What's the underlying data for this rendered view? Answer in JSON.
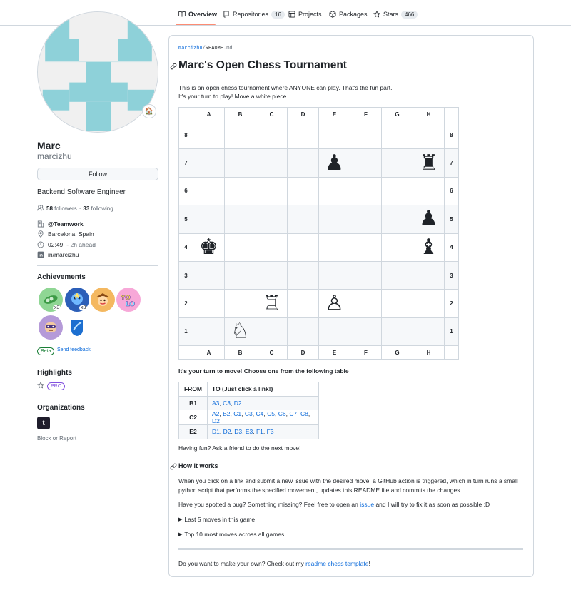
{
  "nav": {
    "tabs": [
      {
        "label": "Overview",
        "icon": "book-icon",
        "active": true
      },
      {
        "label": "Repositories",
        "icon": "repo-icon",
        "count": "16"
      },
      {
        "label": "Projects",
        "icon": "table-icon"
      },
      {
        "label": "Packages",
        "icon": "package-icon"
      },
      {
        "label": "Stars",
        "icon": "star-icon",
        "count": "466"
      }
    ]
  },
  "profile": {
    "name": "Marc",
    "login": "marcizhu",
    "follow_label": "Follow",
    "bio": "Backend Software Engineer",
    "followers_count": "58",
    "followers_label": "followers",
    "following_count": "33",
    "following_label": "following",
    "dot": "·",
    "company": "@Teamwork",
    "location": "Barcelona, Spain",
    "time": "02:49",
    "time_note": "- 2h ahead",
    "linkedin": "in/marcizhu",
    "status_emoji": "🏠"
  },
  "achievements": {
    "title": "Achievements",
    "badges": [
      {
        "name": "pair-extraordinaire",
        "multiplier": "x3",
        "color": "#8fd694"
      },
      {
        "name": "starstruck",
        "multiplier": "x3",
        "color": "#2c5fb8"
      },
      {
        "name": "quickdraw",
        "color": "#f4b860"
      },
      {
        "name": "yolo",
        "color": "#f7a8d8"
      },
      {
        "name": "pull-shark",
        "color": "#b59ad8"
      },
      {
        "name": "arctic-code-vault",
        "color": "#1d6fd0"
      }
    ],
    "beta_label": "Beta",
    "feedback_label": "Send feedback"
  },
  "highlights": {
    "title": "Highlights",
    "pro_label": "PRO"
  },
  "organizations": {
    "title": "Organizations",
    "org_letter": "t",
    "block_label": "Block or Report"
  },
  "readme": {
    "path_user": "marcizhu",
    "path_sep": "/",
    "path_file_name": "README",
    "path_file_ext": ".md",
    "title": "Marc's Open Chess Tournament",
    "intro_1": "This is an open chess tournament where ANYONE can play. That's the fun part.",
    "intro_2": "It's your turn to play! Move a white piece.",
    "board": {
      "files": [
        "A",
        "B",
        "C",
        "D",
        "E",
        "F",
        "G",
        "H"
      ],
      "ranks": [
        {
          "label": "8",
          "cells": [
            "",
            "",
            "",
            "",
            "",
            "",
            "",
            ""
          ]
        },
        {
          "label": "7",
          "cells": [
            "",
            "",
            "",
            "",
            "♟",
            "",
            "",
            "♜"
          ]
        },
        {
          "label": "6",
          "cells": [
            "",
            "",
            "",
            "",
            "",
            "",
            "",
            ""
          ]
        },
        {
          "label": "5",
          "cells": [
            "",
            "",
            "",
            "",
            "",
            "",
            "",
            "♟"
          ]
        },
        {
          "label": "4",
          "cells": [
            "♚",
            "",
            "",
            "",
            "",
            "",
            "",
            "♝"
          ]
        },
        {
          "label": "3",
          "cells": [
            "",
            "",
            "",
            "",
            "",
            "",
            "",
            ""
          ]
        },
        {
          "label": "2",
          "cells": [
            "",
            "",
            "♖",
            "",
            "♙",
            "",
            "",
            ""
          ]
        },
        {
          "label": "1",
          "cells": [
            "",
            "♘",
            "",
            "",
            "",
            "",
            "",
            ""
          ]
        }
      ]
    },
    "move_prompt": "It's your turn to move! Choose one from the following table",
    "moves_table": {
      "head_from": "FROM",
      "head_to": "TO (Just click a link!)",
      "rows": [
        {
          "from": "B1",
          "to": [
            "A3",
            "C3",
            "D2"
          ]
        },
        {
          "from": "C2",
          "to": [
            "A2",
            "B2",
            "C1",
            "C3",
            "C4",
            "C5",
            "C6",
            "C7",
            "C8",
            "D2"
          ]
        },
        {
          "from": "E2",
          "to": [
            "D1",
            "D2",
            "D3",
            "E3",
            "F1",
            "F3"
          ]
        }
      ]
    },
    "fun_text": "Having fun? Ask a friend to do the next move!",
    "how_title": "How it works",
    "how_text": "When you click on a link and submit a new issue with the desired move, a GitHub action is triggered, which in turn runs a small python script that performs the specified movement, updates this README file and commits the changes.",
    "bug_text_1": "Have you spotted a bug? Something missing? Feel free to open an",
    "bug_link": "issue",
    "bug_text_2": "and I will try to fix it as soon as possible :D",
    "details_1": "Last 5 moves in this game",
    "details_2": "Top 10 most moves across all games",
    "own_text": "Do you want to make your own? Check out my",
    "own_link": "readme chess template",
    "own_end": "!"
  },
  "colors": {
    "accent": "#0969da",
    "tab_underline": "#fd8c73",
    "avatar_identicon": "#8ed1d9"
  }
}
